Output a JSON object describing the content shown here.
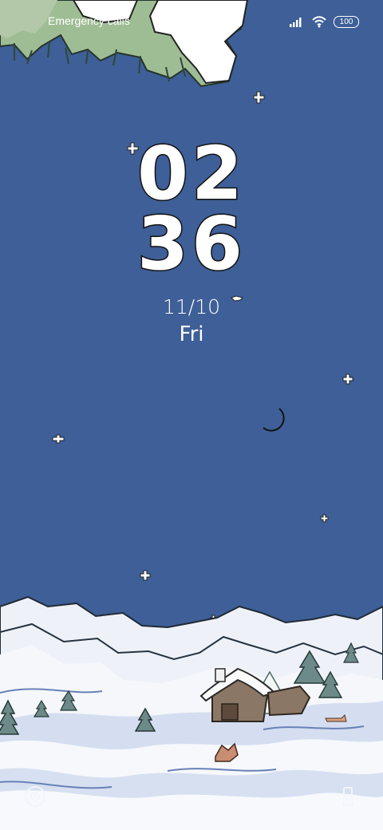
{
  "status_bar": {
    "left_text": "Emergency calls",
    "battery": "100",
    "signal_icon": "signal-icon",
    "wifi_icon": "wifi-icon"
  },
  "lockscreen": {
    "hour": "02",
    "minute": "36",
    "date": "11/10",
    "day": "Fri"
  },
  "bottom_shortcuts": {
    "left_icon": "camera-icon",
    "right_icon": "flashlight-icon"
  },
  "colors": {
    "sky": "#3e5f97",
    "snow": "#f4f6fb",
    "snow_shadow": "#cfdaf1",
    "tree": "#6a8b88",
    "cabin": "#8b7765"
  }
}
